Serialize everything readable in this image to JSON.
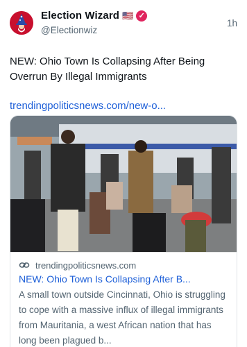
{
  "author": {
    "display_name": "Election Wizard",
    "flag": "🇺🇸",
    "handle": "@Electionwiz",
    "verified_color": "#e0245e",
    "avatar_color": "#c8102e"
  },
  "post": {
    "timestamp": "1h",
    "text": "NEW: Ohio Town Is Collapsing After Being Overrun By Illegal Immigrants",
    "link": "trendingpoliticsnews.com/new-o..."
  },
  "card": {
    "domain": "trendingpoliticsnews.com",
    "title": "NEW: Ohio Town Is Collapsing After B...",
    "description": "A small town outside Cincinnati, Ohio is struggling to cope with a massive influx of illegal immigrants from Mauritania, a west African nation that has long been plagued b..."
  },
  "colors": {
    "link_blue": "#1d5fd8",
    "secondary_text": "#536471"
  }
}
